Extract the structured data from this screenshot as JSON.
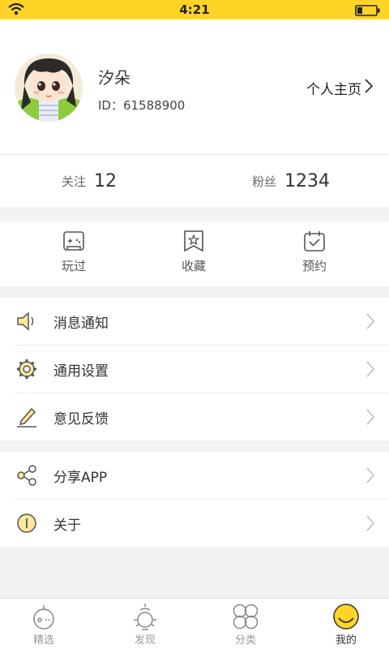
{
  "status_bar": {
    "time": "4:21"
  },
  "profile": {
    "nickname": "汐朵",
    "id_text": "ID：61588900",
    "homepage_label": "个人主页"
  },
  "stats": {
    "following_label": "关注",
    "following_count": "12",
    "fans_label": "粉丝",
    "fans_count": "1234"
  },
  "quick_actions": {
    "played": "玩过",
    "favorites": "收藏",
    "reservations": "预约"
  },
  "settings_group": {
    "notifications": "消息通知",
    "general_settings": "通用设置",
    "feedback": "意见反馈"
  },
  "about_group": {
    "share_app": "分享APP",
    "about": "关于"
  },
  "tab_bar": {
    "featured": "精选",
    "discover": "发现",
    "categories": "分类",
    "mine": "我的"
  },
  "colors": {
    "accent": "#ffd426"
  }
}
